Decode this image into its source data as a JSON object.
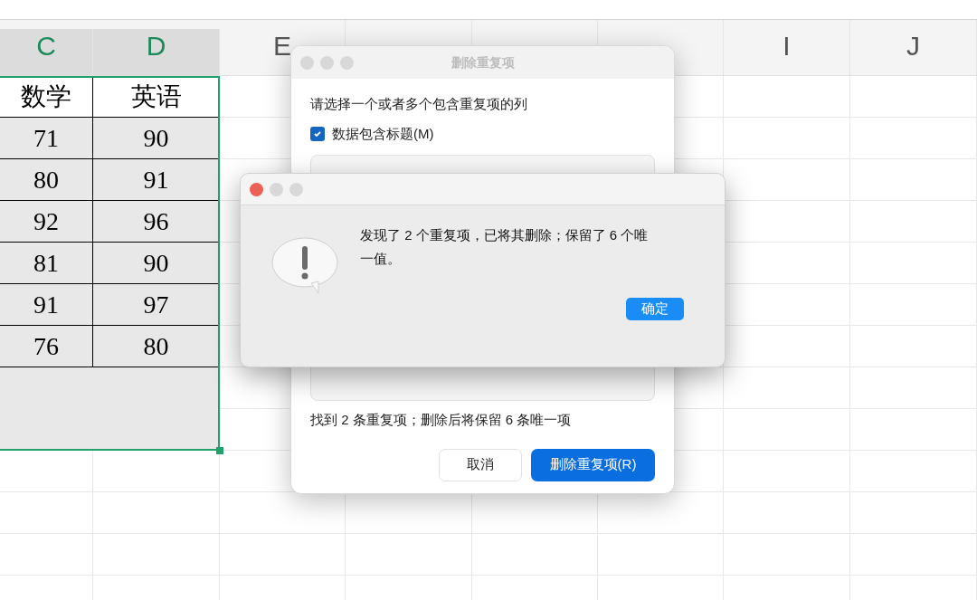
{
  "columns": [
    {
      "label": "C",
      "selected": true
    },
    {
      "label": "D",
      "selected": true
    },
    {
      "label": "E",
      "selected": false
    },
    {
      "selected": false
    },
    {
      "selected": false
    },
    {
      "selected": false
    },
    {
      "label": "I",
      "selected": false
    },
    {
      "label": "J",
      "selected": false
    }
  ],
  "table": {
    "header": [
      "数学",
      "英语"
    ],
    "rows": [
      [
        "71",
        "90"
      ],
      [
        "80",
        "91"
      ],
      [
        "92",
        "96"
      ],
      [
        "81",
        "90"
      ],
      [
        "91",
        "97"
      ],
      [
        "76",
        "80"
      ]
    ]
  },
  "remove_dialog": {
    "title": "删除重复项",
    "prompt": "请选择一个或者多个包含重复项的列",
    "has_headers": {
      "label": "数据包含标题(M)",
      "checked": true
    },
    "summary": "找到 2 条重复项；删除后将保留 6 条唯一项",
    "cancel": "取消",
    "confirm": "删除重复项(R)"
  },
  "alert": {
    "message": "发现了 2 个重复项，已将其删除；保留了 6 个唯一值。",
    "ok": "确定"
  }
}
